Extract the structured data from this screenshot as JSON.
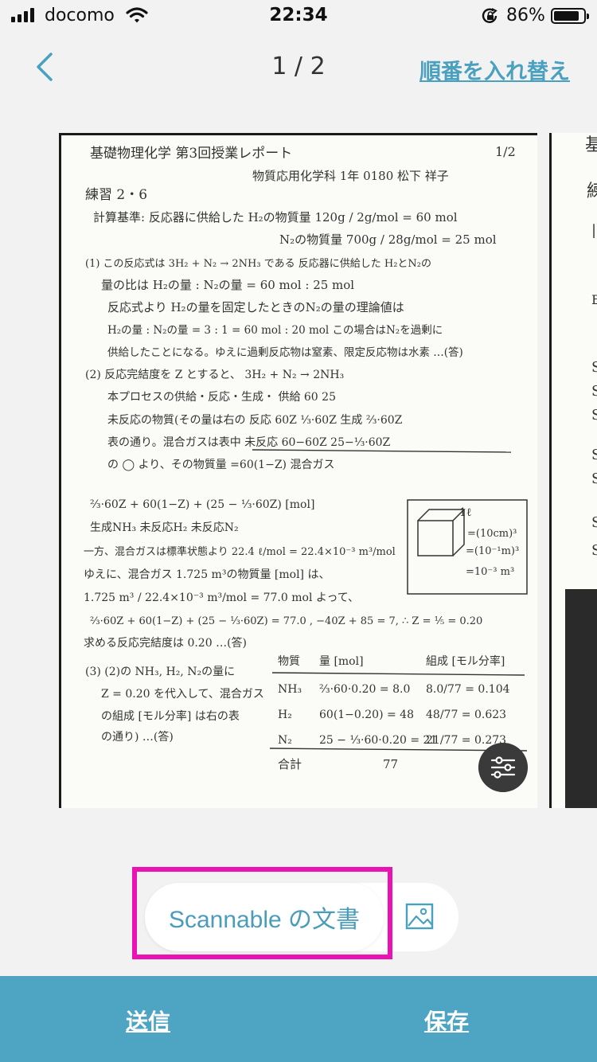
{
  "status_bar": {
    "carrier": "docomo",
    "time": "22:34",
    "battery_percent": "86%",
    "battery_level": 0.86
  },
  "nav": {
    "page_indicator": "1 / 2",
    "reorder_label": "順番を入れ替え"
  },
  "document": {
    "lines": [
      "基礎物理化学  第3回授業レポート",
      "1/2",
      "物質応用化学科 1年 0180 松下 祥子",
      "練習 2・6",
      "計算基準: 反応器に供給した H₂の物質量 120g / 2g/mol = 60 mol",
      "N₂の物質量 700g / 28g/mol = 25 mol",
      "(1) この反応式は 3H₂ + N₂ → 2NH₃ である 反応器に供給した H₂とN₂の",
      "量の比は H₂の量 : N₂の量 = 60 mol : 25 mol",
      "反応式より H₂の量を固定したときのN₂の量の理論値は",
      "H₂の量 : N₂の量 = 3 : 1 = 60 mol : 20 mol  この場合はN₂を過剰に",
      "供給したことになる。ゆえに過剰反応物は窒素、限定反応物は水素 …(答)",
      "(2) 反応完結度を Z とすると、   3H₂  +  N₂  →  2NH₃",
      "本プロセスの供給・反応・生成・  供給   60      25",
      "未反応の物質(その量は右の    反応   60Z   ⅓·60Z   生成 ⅔·60Z",
      "表の通り。混合ガスは表中     未反応 60−60Z   25−⅓·60Z",
      "の ◯ より、その物質量       =60(1−Z)          混合ガス",
      "⅔·60Z + 60(1−Z) + (25 − ⅓·60Z)  [mol]",
      "生成NH₃    未反応H₂    未反応N₂",
      "一方、混合ガスは標準状態より 22.4 ℓ/mol = 22.4×10⁻³ m³/mol",
      "ゆえに、混合ガス 1.725 m³の物質量 [mol] は、",
      "1.725 m³ / 22.4×10⁻³ m³/mol = 77.0 mol   よって、",
      "⅔·60Z + 60(1−Z) + (25 − ⅓·60Z) = 77.0 ,  −40Z + 85 = 7,  ∴ Z = ⅕ = 0.20",
      "求める反応完結度は 0.20 …(答)",
      "(3) (2)の NH₃, H₂, N₂の量に",
      "Z = 0.20 を代入して、混合ガス",
      "の組成 [モル分率] は右の表",
      "の通り)      …(答)"
    ],
    "cube_lines": [
      "1ℓ",
      "=(10cm)³",
      "=(10⁻¹m)³",
      "=10⁻³ m³"
    ],
    "table": {
      "headers": [
        "物質",
        "量 [mol]",
        "組成 [モル分率]"
      ],
      "rows": [
        [
          "NH₃",
          "⅔·60·0.20 = 8.0",
          "8.0/77 = 0.104"
        ],
        [
          "H₂",
          "60(1−0.20) = 48",
          "48/77 = 0.623"
        ],
        [
          "N₂",
          "25 − ⅓·60·0.20 = 21",
          "21/77 = 0.273"
        ]
      ],
      "total": [
        "合計",
        "77",
        ""
      ]
    }
  },
  "source_selector": {
    "scannable_label": "Scannable の文書"
  },
  "bottom_bar": {
    "send_label": "送信",
    "save_label": "保存"
  },
  "colors": {
    "accent": "#4aa0bf",
    "bottom_bar": "#4ea4c3",
    "highlight": "#ea12b3",
    "background": "#f2f2f3"
  },
  "icons": [
    "back-chevron-icon",
    "wifi-icon",
    "rotation-lock-icon",
    "battery-icon",
    "filter-sliders-icon",
    "photo-icon"
  ]
}
